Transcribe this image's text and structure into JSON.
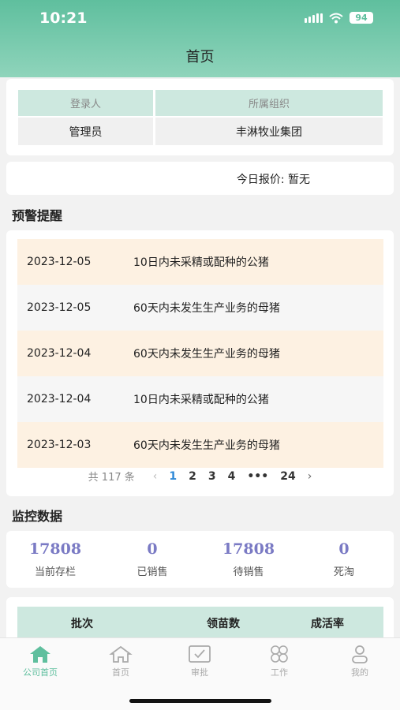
{
  "status_bar": {
    "time": "10:21",
    "battery": "94"
  },
  "header": {
    "title": "首页"
  },
  "login": {
    "headers": [
      "登录人",
      "所属组织"
    ],
    "values": [
      "管理员",
      "丰淋牧业集团"
    ]
  },
  "price": {
    "text": "今日报价: 暂无"
  },
  "alerts": {
    "title": "预警提醒",
    "rows": [
      {
        "date": "2023-12-05",
        "desc": "10日内未采精或配种的公猪"
      },
      {
        "date": "2023-12-05",
        "desc": "60天内未发生生产业务的母猪"
      },
      {
        "date": "2023-12-04",
        "desc": "60天内未发生生产业务的母猪"
      },
      {
        "date": "2023-12-04",
        "desc": "10日内未采精或配种的公猪"
      },
      {
        "date": "2023-12-03",
        "desc": "60天内未发生生产业务的母猪"
      }
    ],
    "pager": {
      "total": "共 117 条",
      "prev": "‹",
      "pages": [
        "1",
        "2",
        "3",
        "4",
        "•••",
        "24"
      ],
      "active_page": "1",
      "next": "›"
    }
  },
  "monitor": {
    "title": "监控数据",
    "items": [
      {
        "value": "17808",
        "label": "当前存栏"
      },
      {
        "value": "0",
        "label": "已销售"
      },
      {
        "value": "17808",
        "label": "待销售"
      },
      {
        "value": "0",
        "label": "死淘"
      }
    ]
  },
  "batch_table": {
    "headers": [
      "批次",
      "领苗数",
      "成活率"
    ]
  },
  "tabbar": {
    "active_color": "#5fbf9e",
    "inactive_color": "#aaaaaa",
    "items": [
      {
        "label": "公司首页",
        "icon": "home-filled-icon",
        "active": true
      },
      {
        "label": "首页",
        "icon": "home-outline-icon",
        "active": false
      },
      {
        "label": "审批",
        "icon": "approve-check-icon",
        "active": false
      },
      {
        "label": "工作",
        "icon": "work-clover-icon",
        "active": false
      },
      {
        "label": "我的",
        "icon": "user-icon",
        "active": false
      }
    ]
  }
}
